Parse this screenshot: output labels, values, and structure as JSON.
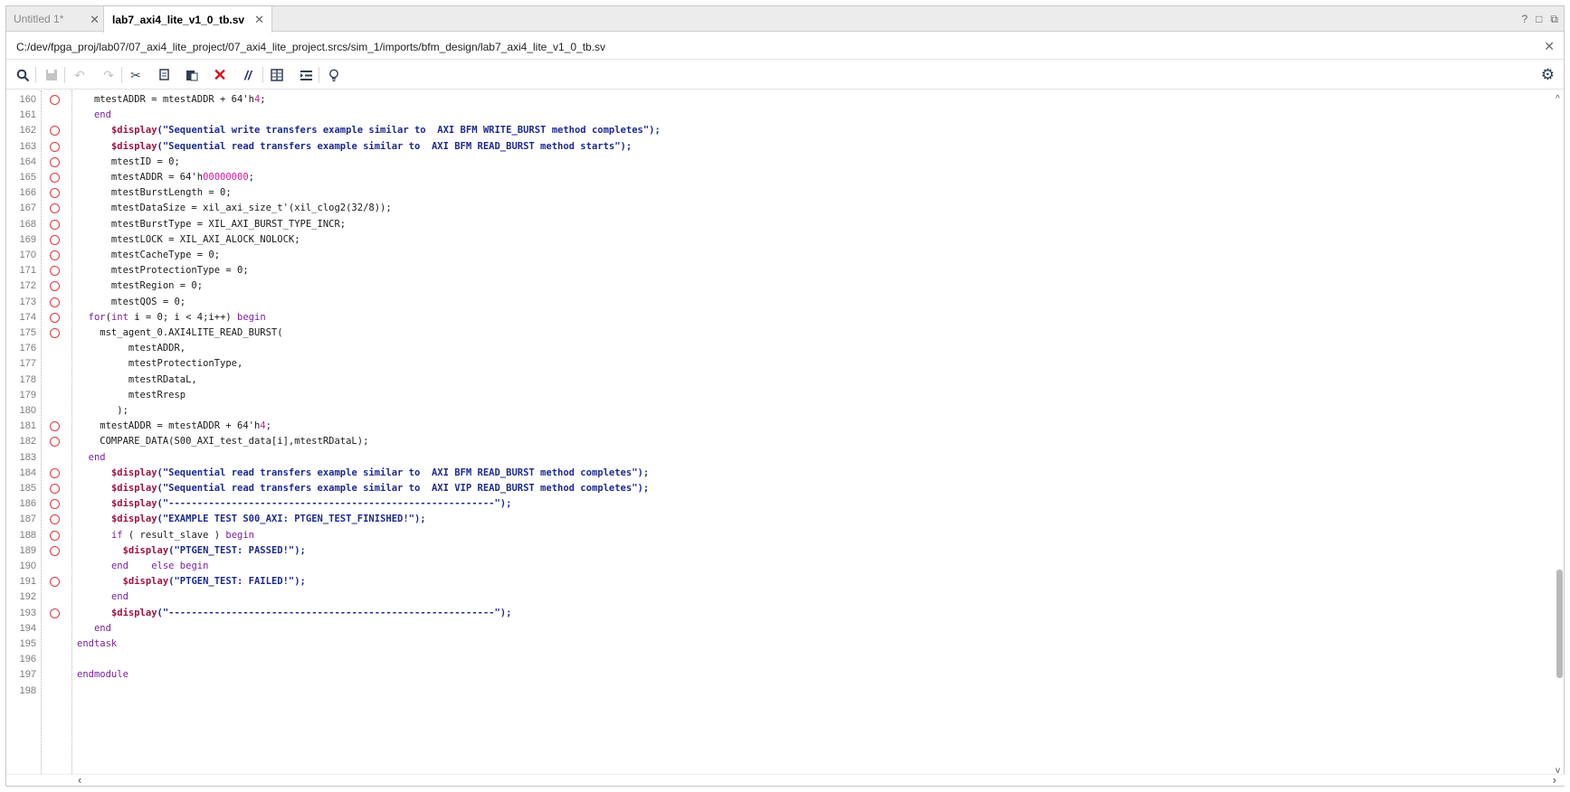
{
  "tabs": [
    {
      "label": "Untitled 1*",
      "active": false
    },
    {
      "label": "lab7_axi4_lite_v1_0_tb.sv",
      "active": true
    }
  ],
  "window_controls": [
    "?",
    "□",
    "⧉"
  ],
  "file_path": "C:/dev/fpga_proj/lab07/07_axi4_lite_project/07_axi4_lite_project.srcs/sim_1/imports/bfm_design/lab7_axi4_lite_v1_0_tb.sv",
  "toolbar": {
    "icons": [
      "search-icon",
      "save-icon",
      "undo-icon",
      "redo-icon",
      "cut-icon",
      "copy-icon",
      "paste-icon",
      "delete-icon",
      "comment-icon",
      "split-view-icon",
      "indent-icon",
      "lightbulb-icon"
    ],
    "settings_icon": "gear-icon"
  },
  "colors": {
    "keyword": "#7a1fa2",
    "system_task": "#a0123f",
    "string": "#1d2a8f",
    "number": "#d6179a",
    "breakpoint": "#e0393e"
  },
  "lines": [
    {
      "n": "160",
      "bp": true,
      "html": "   mtestADDR = mtestADDR + 64'h<span class='num'>4</span>;"
    },
    {
      "n": "161",
      "bp": false,
      "html": "   <span class='kw'>end</span>"
    },
    {
      "n": "162",
      "bp": true,
      "html": "      <span class='sys'>$display</span><span class='str'>(\"Sequential write transfers example similar to  AXI BFM WRITE_BURST method completes\");</span>"
    },
    {
      "n": "163",
      "bp": true,
      "html": "      <span class='sys'>$display</span><span class='str'>(\"Sequential read transfers example similar to  AXI BFM READ_BURST method starts\");</span>"
    },
    {
      "n": "164",
      "bp": true,
      "html": "      mtestID = 0;"
    },
    {
      "n": "165",
      "bp": true,
      "html": "      mtestADDR = 64'h<span class='num'>00000000</span>;"
    },
    {
      "n": "166",
      "bp": true,
      "html": "      mtestBurstLength = 0;"
    },
    {
      "n": "167",
      "bp": true,
      "html": "      mtestDataSize = xil_axi_size_t'(xil_clog2(32/8));"
    },
    {
      "n": "168",
      "bp": true,
      "html": "      mtestBurstType = XIL_AXI_BURST_TYPE_INCR;"
    },
    {
      "n": "169",
      "bp": true,
      "html": "      mtestLOCK = XIL_AXI_ALOCK_NOLOCK;"
    },
    {
      "n": "170",
      "bp": true,
      "html": "      mtestCacheType = 0;"
    },
    {
      "n": "171",
      "bp": true,
      "html": "      mtestProtectionType = 0;"
    },
    {
      "n": "172",
      "bp": true,
      "html": "      mtestRegion = 0;"
    },
    {
      "n": "173",
      "bp": true,
      "html": "      mtestQOS = 0;"
    },
    {
      "n": "174",
      "bp": true,
      "html": "  <span class='kw'>for</span>(<span class='kw'>int</span> i = 0; i < 4;i++) <span class='kw'>begin</span>"
    },
    {
      "n": "175",
      "bp": true,
      "html": "    mst_agent_0.AXI4LITE_READ_BURST("
    },
    {
      "n": "176",
      "bp": false,
      "html": "         mtestADDR,"
    },
    {
      "n": "177",
      "bp": false,
      "html": "         mtestProtectionType,"
    },
    {
      "n": "178",
      "bp": false,
      "html": "         mtestRDataL,"
    },
    {
      "n": "179",
      "bp": false,
      "html": "         mtestRresp"
    },
    {
      "n": "180",
      "bp": false,
      "html": "       );"
    },
    {
      "n": "181",
      "bp": true,
      "html": "    mtestADDR = mtestADDR + 64'h<span class='num'>4</span>;"
    },
    {
      "n": "182",
      "bp": true,
      "html": "    COMPARE_DATA(S00_AXI_test_data[i],mtestRDataL);"
    },
    {
      "n": "183",
      "bp": false,
      "html": "  <span class='kw'>end</span>"
    },
    {
      "n": "184",
      "bp": true,
      "html": "      <span class='sys'>$display</span><span class='str'>(\"Sequential read transfers example similar to  AXI BFM READ_BURST method completes\");</span>"
    },
    {
      "n": "185",
      "bp": true,
      "html": "      <span class='sys'>$display</span><span class='str'>(\"Sequential read transfers example similar to  AXI VIP READ_BURST method completes\");</span>"
    },
    {
      "n": "186",
      "bp": true,
      "html": "      <span class='sys'>$display</span><span class='str'>(\"---------------------------------------------------------\");</span>"
    },
    {
      "n": "187",
      "bp": true,
      "html": "      <span class='sys'>$display</span><span class='str'>(\"EXAMPLE TEST S00_AXI: PTGEN_TEST_FINISHED!\");</span>"
    },
    {
      "n": "188",
      "bp": true,
      "html": "      <span class='kw'>if</span> ( result_slave ) <span class='kw'>begin</span>"
    },
    {
      "n": "189",
      "bp": true,
      "html": "        <span class='sys'>$display</span><span class='str'>(\"PTGEN_TEST: PASSED!\");</span>"
    },
    {
      "n": "190",
      "bp": false,
      "html": "      <span class='kw'>end</span>    <span class='kw'>else begin</span>"
    },
    {
      "n": "191",
      "bp": true,
      "html": "        <span class='sys'>$display</span><span class='str'>(\"PTGEN_TEST: FAILED!\");</span>"
    },
    {
      "n": "192",
      "bp": false,
      "html": "      <span class='kw'>end</span>"
    },
    {
      "n": "193",
      "bp": true,
      "html": "      <span class='sys'>$display</span><span class='str'>(\"---------------------------------------------------------\");</span>"
    },
    {
      "n": "194",
      "bp": false,
      "html": "   <span class='kw'>end</span>"
    },
    {
      "n": "195",
      "bp": false,
      "html": "<span class='kw'>endtask</span>"
    },
    {
      "n": "196",
      "bp": false,
      "html": ""
    },
    {
      "n": "197",
      "bp": false,
      "html": "<span class='kw'>endmodule</span>"
    },
    {
      "n": "198",
      "bp": false,
      "html": ""
    }
  ]
}
